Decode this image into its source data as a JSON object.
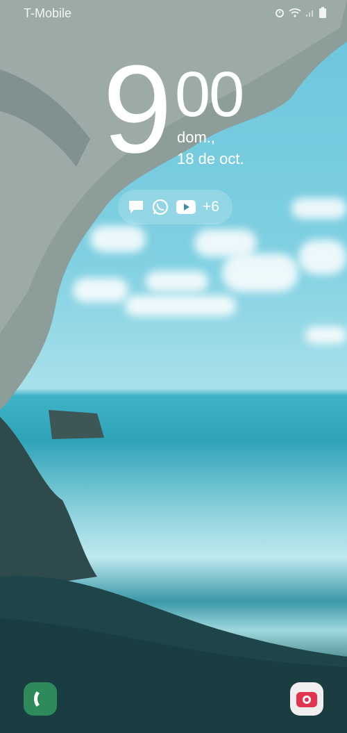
{
  "status_bar": {
    "carrier": "T-Mobile",
    "icons": [
      "alarm-icon",
      "wifi-icon",
      "signal-icon",
      "battery-icon"
    ]
  },
  "lock_screen": {
    "clock_hour": "9",
    "clock_minutes": "00",
    "date_day": "dom.,",
    "date_full": "18 de oct.",
    "notifications": {
      "icons": [
        "message-icon",
        "whatsapp-icon",
        "youtube-icon"
      ],
      "more_count": "+6"
    }
  },
  "shortcuts": {
    "left": "phone-icon",
    "right": "camera-icon"
  },
  "colors": {
    "phone_shortcut": "#2e8a5a",
    "camera_shortcut_bg": "#f1eef0",
    "camera_icon": "#e0344f"
  }
}
